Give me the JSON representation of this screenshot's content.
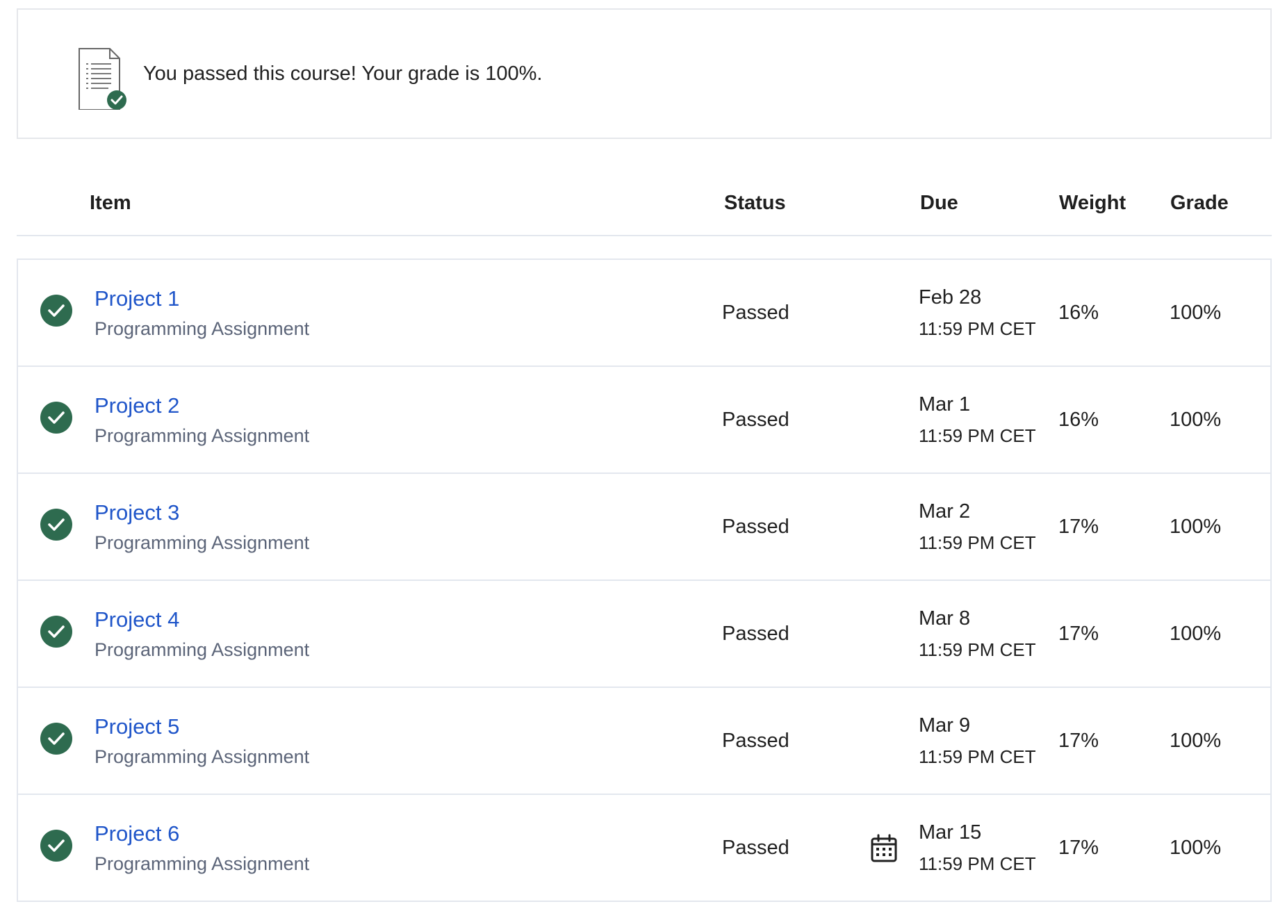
{
  "banner": {
    "message": "You passed this course! Your grade is 100%.",
    "icon": "document-check-icon"
  },
  "table": {
    "headers": {
      "item": "Item",
      "status": "Status",
      "due": "Due",
      "weight": "Weight",
      "grade": "Grade"
    },
    "rows": [
      {
        "title": "Project 1",
        "type": "Programming Assignment",
        "status": "Passed",
        "due_date": "Feb 28",
        "due_time": "11:59 PM CET",
        "weight": "16%",
        "grade": "100%"
      },
      {
        "title": "Project 2",
        "type": "Programming Assignment",
        "status": "Passed",
        "due_date": "Mar 1",
        "due_time": "11:59 PM CET",
        "weight": "16%",
        "grade": "100%"
      },
      {
        "title": "Project 3",
        "type": "Programming Assignment",
        "status": "Passed",
        "due_date": "Mar 2",
        "due_time": "11:59 PM CET",
        "weight": "17%",
        "grade": "100%"
      },
      {
        "title": "Project 4",
        "type": "Programming Assignment",
        "status": "Passed",
        "due_date": "Mar 8",
        "due_time": "11:59 PM CET",
        "weight": "17%",
        "grade": "100%"
      },
      {
        "title": "Project 5",
        "type": "Programming Assignment",
        "status": "Passed",
        "due_date": "Mar 9",
        "due_time": "11:59 PM CET",
        "weight": "17%",
        "grade": "100%"
      },
      {
        "title": "Project 6",
        "type": "Programming Assignment",
        "status": "Passed",
        "due_date": "Mar 15",
        "due_time": "11:59 PM CET",
        "weight": "17%",
        "grade": "100%"
      }
    ]
  },
  "colors": {
    "link": "#1f55c9",
    "success": "#2e6b4f",
    "muted": "#5b6478",
    "border": "#e3e7ee"
  }
}
